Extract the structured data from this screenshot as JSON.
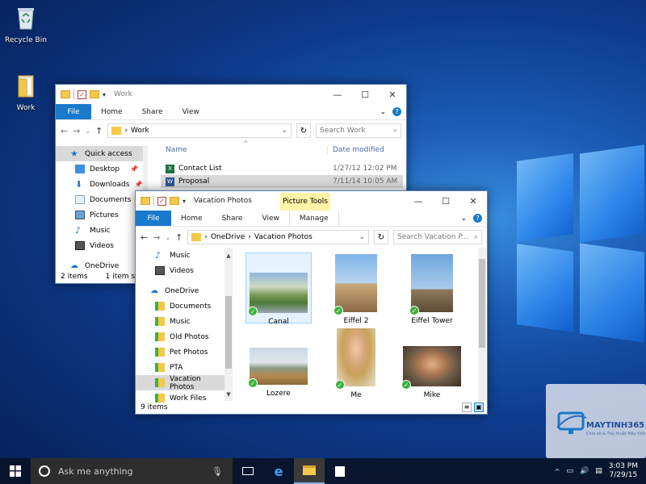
{
  "desktop": {
    "icons": [
      {
        "label": "Recycle Bin"
      },
      {
        "label": "Work"
      }
    ]
  },
  "window_work": {
    "title": "Work",
    "ribbon": {
      "file": "File",
      "tabs": [
        "Home",
        "Share",
        "View"
      ]
    },
    "address": "Work",
    "search_placeholder": "Search Work",
    "nav": [
      {
        "label": "Quick access"
      },
      {
        "label": "Desktop"
      },
      {
        "label": "Downloads"
      },
      {
        "label": "Documents"
      },
      {
        "label": "Pictures"
      },
      {
        "label": "Music"
      },
      {
        "label": "Videos"
      },
      {
        "label": "OneDrive"
      }
    ],
    "columns": {
      "name": "Name",
      "date": "Date modified"
    },
    "files": [
      {
        "name": "Contact List",
        "date": "1/27/12 12:02 PM"
      },
      {
        "name": "Proposal",
        "date": "7/11/14 10:05 AM"
      }
    ],
    "status": {
      "count": "2 items",
      "selected": "1 item sele"
    }
  },
  "window_photos": {
    "title": "Vacation Photos",
    "context_tab": "Picture Tools",
    "ribbon": {
      "file": "File",
      "tabs": [
        "Home",
        "Share",
        "View"
      ],
      "manage": "Manage"
    },
    "address": {
      "root": "OneDrive",
      "folder": "Vacation Photos"
    },
    "search_placeholder": "Search Vacation P...",
    "nav": [
      {
        "label": "Music"
      },
      {
        "label": "Videos"
      },
      {
        "label": "OneDrive"
      },
      {
        "label": "Documents"
      },
      {
        "label": "Music"
      },
      {
        "label": "Old Photos"
      },
      {
        "label": "Pet Photos"
      },
      {
        "label": "PTA"
      },
      {
        "label": "Vacation Photos"
      },
      {
        "label": "Work Files"
      }
    ],
    "photos": [
      {
        "name": "Canal"
      },
      {
        "name": "Eiffel 2"
      },
      {
        "name": "Eiffel Tower"
      },
      {
        "name": "Lozere"
      },
      {
        "name": "Me"
      },
      {
        "name": "Mike"
      }
    ],
    "status": "9 items"
  },
  "taskbar": {
    "search_text": "Ask me anything",
    "time": "3:03 PM",
    "date": "7/29/15"
  },
  "watermark": {
    "brand": "MAYTINH365",
    "tagline": "Chia sẻ & Thủ thuật Máy tính"
  },
  "colors": {
    "accent": "#1979ca",
    "sync_badge": "#3bb33b",
    "context_tab": "#fff3a6"
  }
}
